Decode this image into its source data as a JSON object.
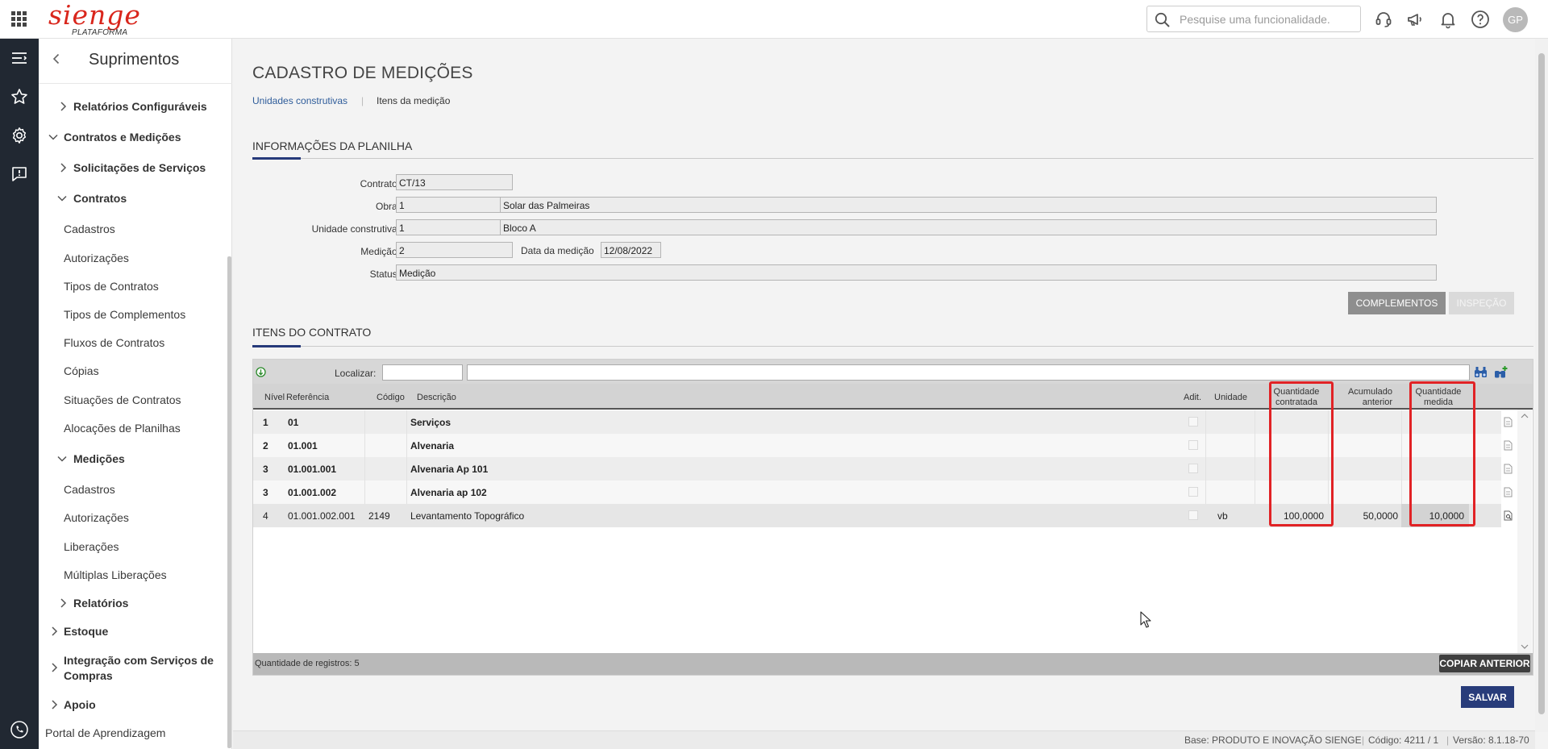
{
  "brand": {
    "logo": "sienge",
    "sub": "PLATAFORMA"
  },
  "topbar": {
    "search_placeholder": "Pesquise uma funcionalidade.",
    "avatar": "GP"
  },
  "sidebar": {
    "title": "Suprimentos",
    "items": [
      {
        "label": "Relatórios Configuráveis",
        "bold": true
      },
      {
        "label": "Contratos e Medições",
        "bold": true
      },
      {
        "label": "Solicitações de Serviços",
        "bold": true
      },
      {
        "label": "Contratos",
        "bold": true
      },
      {
        "label": "Cadastros"
      },
      {
        "label": "Autorizações"
      },
      {
        "label": "Tipos de Contratos"
      },
      {
        "label": "Tipos de Complementos"
      },
      {
        "label": "Fluxos de Contratos"
      },
      {
        "label": "Cópias"
      },
      {
        "label": "Situações de Contratos"
      },
      {
        "label": "Alocações de Planilhas"
      },
      {
        "label": "Medições",
        "bold": true
      },
      {
        "label": "Cadastros"
      },
      {
        "label": "Autorizações"
      },
      {
        "label": "Liberações"
      },
      {
        "label": "Múltiplas Liberações"
      },
      {
        "label": "Relatórios",
        "bold": true
      },
      {
        "label": "Estoque",
        "bold": true
      },
      {
        "label": "Integração com Serviços de",
        "bold": true
      },
      {
        "label": "Compras",
        "bold": true
      },
      {
        "label": "Apoio",
        "bold": true
      },
      {
        "label": "Portal de Aprendizagem"
      }
    ]
  },
  "page": {
    "title": "CADASTRO DE MEDIÇÕES",
    "breadcrumb": [
      "Unidades construtivas",
      "Itens da medição"
    ]
  },
  "planilha": {
    "title": "INFORMAÇÕES DA PLANILHA",
    "contrato_label": "Contrato:",
    "contrato": "CT/13",
    "obra_label": "Obra:",
    "obra_code": "1",
    "obra_name": "Solar das Palmeiras",
    "unidade_label": "Unidade construtiva:",
    "unidade_code": "1",
    "unidade_name": "Bloco A",
    "medicao_label": "Medição:",
    "medicao": "2",
    "data_label": "Data da medição",
    "data": "12/08/2022",
    "status_label": "Status:",
    "status": "Medição",
    "btn_complementos": "COMPLEMENTOS",
    "btn_inspecao": "INSPEÇÃO"
  },
  "itens": {
    "title": "ITENS DO CONTRATO",
    "localizar_label": "Localizar:",
    "headers": {
      "nivel": "Nível",
      "referencia": "Referência",
      "codigo": "Código",
      "descricao": "Descrição",
      "adit": "Adit.",
      "unidade": "Unidade",
      "qtd_contratada_1": "Quantidade",
      "qtd_contratada_2": "contratada",
      "acumulado_1": "Acumulado",
      "acumulado_2": "anterior",
      "qtd_medida_1": "Quantidade",
      "qtd_medida_2": "medida"
    },
    "rows": [
      {
        "nivel": "1",
        "ref": "01",
        "codigo": "",
        "descricao": "Serviços",
        "unidade": "",
        "qtd": "",
        "acum": "",
        "medida": "",
        "bold": true
      },
      {
        "nivel": "2",
        "ref": "01.001",
        "codigo": "",
        "descricao": "Alvenaria",
        "unidade": "",
        "qtd": "",
        "acum": "",
        "medida": "",
        "bold": true
      },
      {
        "nivel": "3",
        "ref": "01.001.001",
        "codigo": "",
        "descricao": "Alvenaria Ap 101",
        "unidade": "",
        "qtd": "",
        "acum": "",
        "medida": "",
        "bold": true
      },
      {
        "nivel": "3",
        "ref": "01.001.002",
        "codigo": "",
        "descricao": "Alvenaria ap 102",
        "unidade": "",
        "qtd": "",
        "acum": "",
        "medida": "",
        "bold": true
      },
      {
        "nivel": "4",
        "ref": "01.001.002.001",
        "codigo": "2149",
        "descricao": "Levantamento Topográfico",
        "unidade": "vb",
        "qtd": "100,0000",
        "acum": "50,0000",
        "medida": "10,0000",
        "bold": false
      }
    ],
    "footer_count": "Quantidade de registros: 5",
    "btn_copiar": "COPIAR ANTERIOR"
  },
  "actions": {
    "salvar": "SALVAR"
  },
  "status_bar": {
    "base": "Base: PRODUTO E INOVAÇÃO SIENGE",
    "codigo": "Código: 4211 / 1",
    "versao": "Versão: 8.1.18-70"
  },
  "colors": {
    "brand_red": "#d9261c",
    "primary": "#283c7a",
    "highlight": "#e12225",
    "rail": "#212832"
  }
}
